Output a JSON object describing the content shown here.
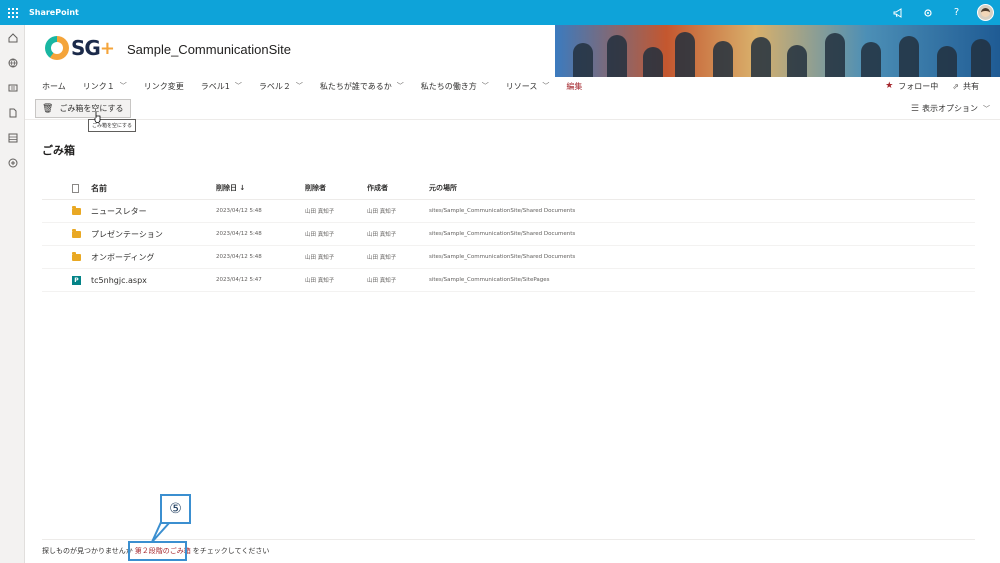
{
  "suite": {
    "app_title": "SharePoint"
  },
  "header": {
    "site_title": "Sample_CommunicationSite",
    "logo_text": "SG",
    "logo_plus": "+"
  },
  "nav": {
    "items": [
      {
        "label": "ホーム",
        "dropdown": false
      },
      {
        "label": "リンク１",
        "dropdown": true
      },
      {
        "label": "リンク変更",
        "dropdown": false
      },
      {
        "label": "ラベル1",
        "dropdown": true
      },
      {
        "label": "ラベル２",
        "dropdown": true
      },
      {
        "label": "私たちが誰であるか",
        "dropdown": true
      },
      {
        "label": "私たちの働き方",
        "dropdown": true
      },
      {
        "label": "リソース",
        "dropdown": true
      }
    ],
    "edit_label": "編集",
    "follow_label": "フォロー中",
    "share_label": "共有"
  },
  "commands": {
    "empty_recycle_label": "ごみ箱を空にする",
    "tooltip": "ごみ箱を空にする",
    "view_options_label": "表示オプション"
  },
  "page": {
    "title": "ごみ箱"
  },
  "list": {
    "columns": {
      "name": "名前",
      "deleted": "削除日 ↓",
      "deleted_by": "削除者",
      "author": "作成者",
      "location": "元の場所"
    },
    "rows": [
      {
        "type": "folder",
        "name": "ニュースレター",
        "deleted": "2023/04/12 5:48",
        "deleted_by": "山田 真知子",
        "author": "山田 真知子",
        "location": "sites/Sample_CommunicationSite/Shared Documents"
      },
      {
        "type": "folder",
        "name": "プレゼンテーション",
        "deleted": "2023/04/12 5:48",
        "deleted_by": "山田 真知子",
        "author": "山田 真知子",
        "location": "sites/Sample_CommunicationSite/Shared Documents"
      },
      {
        "type": "folder",
        "name": "オンボーディング",
        "deleted": "2023/04/12 5:48",
        "deleted_by": "山田 真知子",
        "author": "山田 真知子",
        "location": "sites/Sample_CommunicationSite/Shared Documents"
      },
      {
        "type": "page",
        "name": "tc5nhgjc.aspx",
        "deleted": "2023/04/12 5:47",
        "deleted_by": "山田 真知子",
        "author": "山田 真知子",
        "location": "sites/Sample_CommunicationSite/SitePages"
      }
    ]
  },
  "footer": {
    "prefix": "探しものが見つかりませんか",
    "link": "第２段階のごみ箱",
    "suffix": "をチェックしてください"
  },
  "annotation": {
    "badge": "⑤"
  },
  "colors": {
    "suite_bar": "#0ea3d9",
    "accent": "#a4262c",
    "callout": "#3b8fd0"
  }
}
